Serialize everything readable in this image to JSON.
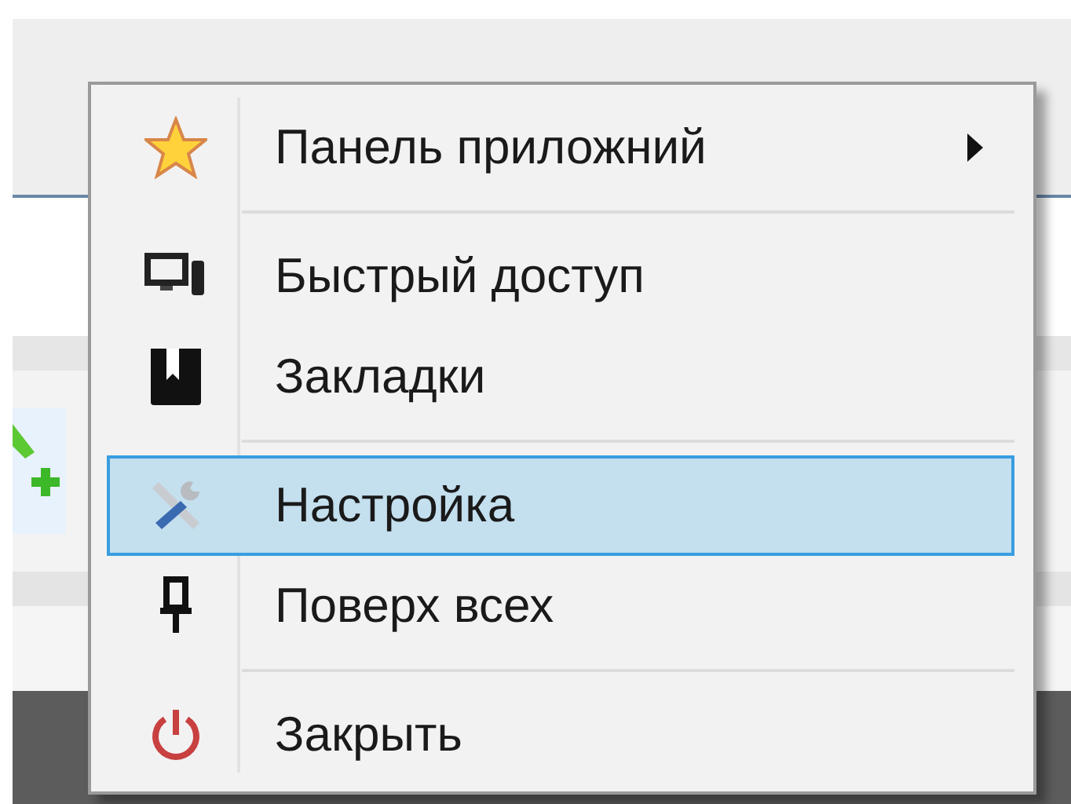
{
  "context_menu": {
    "items": [
      {
        "kind": "item",
        "label": "Панель приложний",
        "selected": false,
        "has_submenu": true
      },
      {
        "kind": "separator"
      },
      {
        "kind": "item",
        "label": "Быстрый доступ",
        "selected": false,
        "has_submenu": false
      },
      {
        "kind": "item",
        "label": "Закладки",
        "selected": false,
        "has_submenu": false
      },
      {
        "kind": "separator"
      },
      {
        "kind": "item",
        "label": "Настройка",
        "selected": true,
        "has_submenu": false
      },
      {
        "kind": "item",
        "label": "Поверх всех",
        "selected": false,
        "has_submenu": false
      },
      {
        "kind": "separator"
      },
      {
        "kind": "item",
        "label": "Закрыть",
        "selected": false,
        "has_submenu": false
      }
    ]
  }
}
